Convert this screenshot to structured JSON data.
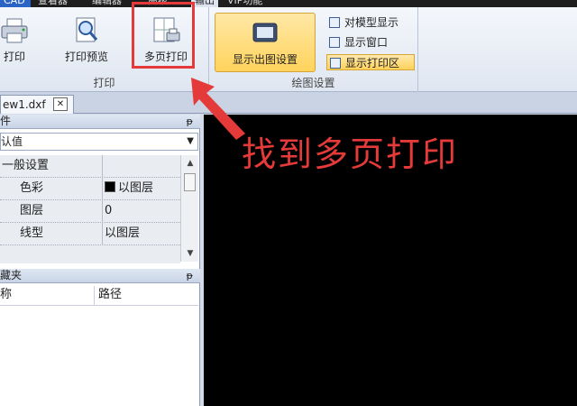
{
  "menu": {
    "tabs": [
      {
        "label": "CAD"
      },
      {
        "label": "查看器"
      },
      {
        "label": "编辑器"
      },
      {
        "label": "高级"
      },
      {
        "label": "输出"
      },
      {
        "label": "VIP功能"
      }
    ]
  },
  "ribbon": {
    "print_group": {
      "label": "打印",
      "buttons": [
        {
          "label": "打印",
          "icon": "printer-icon"
        },
        {
          "label": "打印预览",
          "icon": "print-preview-icon"
        },
        {
          "label": "多页打印",
          "icon": "multi-page-print-icon"
        }
      ]
    },
    "draw_group": {
      "label": "绘图设置",
      "main_button": {
        "label": "显示出图设置",
        "icon": "display-settings-icon"
      },
      "small_buttons": [
        {
          "label": "对模型显示",
          "icon": "model-display-icon"
        },
        {
          "label": "显示窗口",
          "icon": "window-icon"
        },
        {
          "label": "显示打印区",
          "icon": "print-area-icon"
        }
      ]
    }
  },
  "doc_tabs": [
    {
      "label": "ew1.dxf",
      "close": "✕"
    }
  ],
  "properties": {
    "title": "件",
    "pin": "ᵽ",
    "combo_value": "认值",
    "section": "一般设置",
    "rows": [
      {
        "key": "色彩",
        "value": "以图层",
        "swatch": "#000000"
      },
      {
        "key": "图层",
        "value": "0"
      },
      {
        "key": "线型",
        "value": "以图层"
      }
    ]
  },
  "favorites": {
    "title": "藏夹",
    "pin": "ᵽ",
    "columns": [
      "称",
      "路径"
    ]
  },
  "annotation": {
    "text": "找到多页打印",
    "color": "#e53a3a"
  }
}
